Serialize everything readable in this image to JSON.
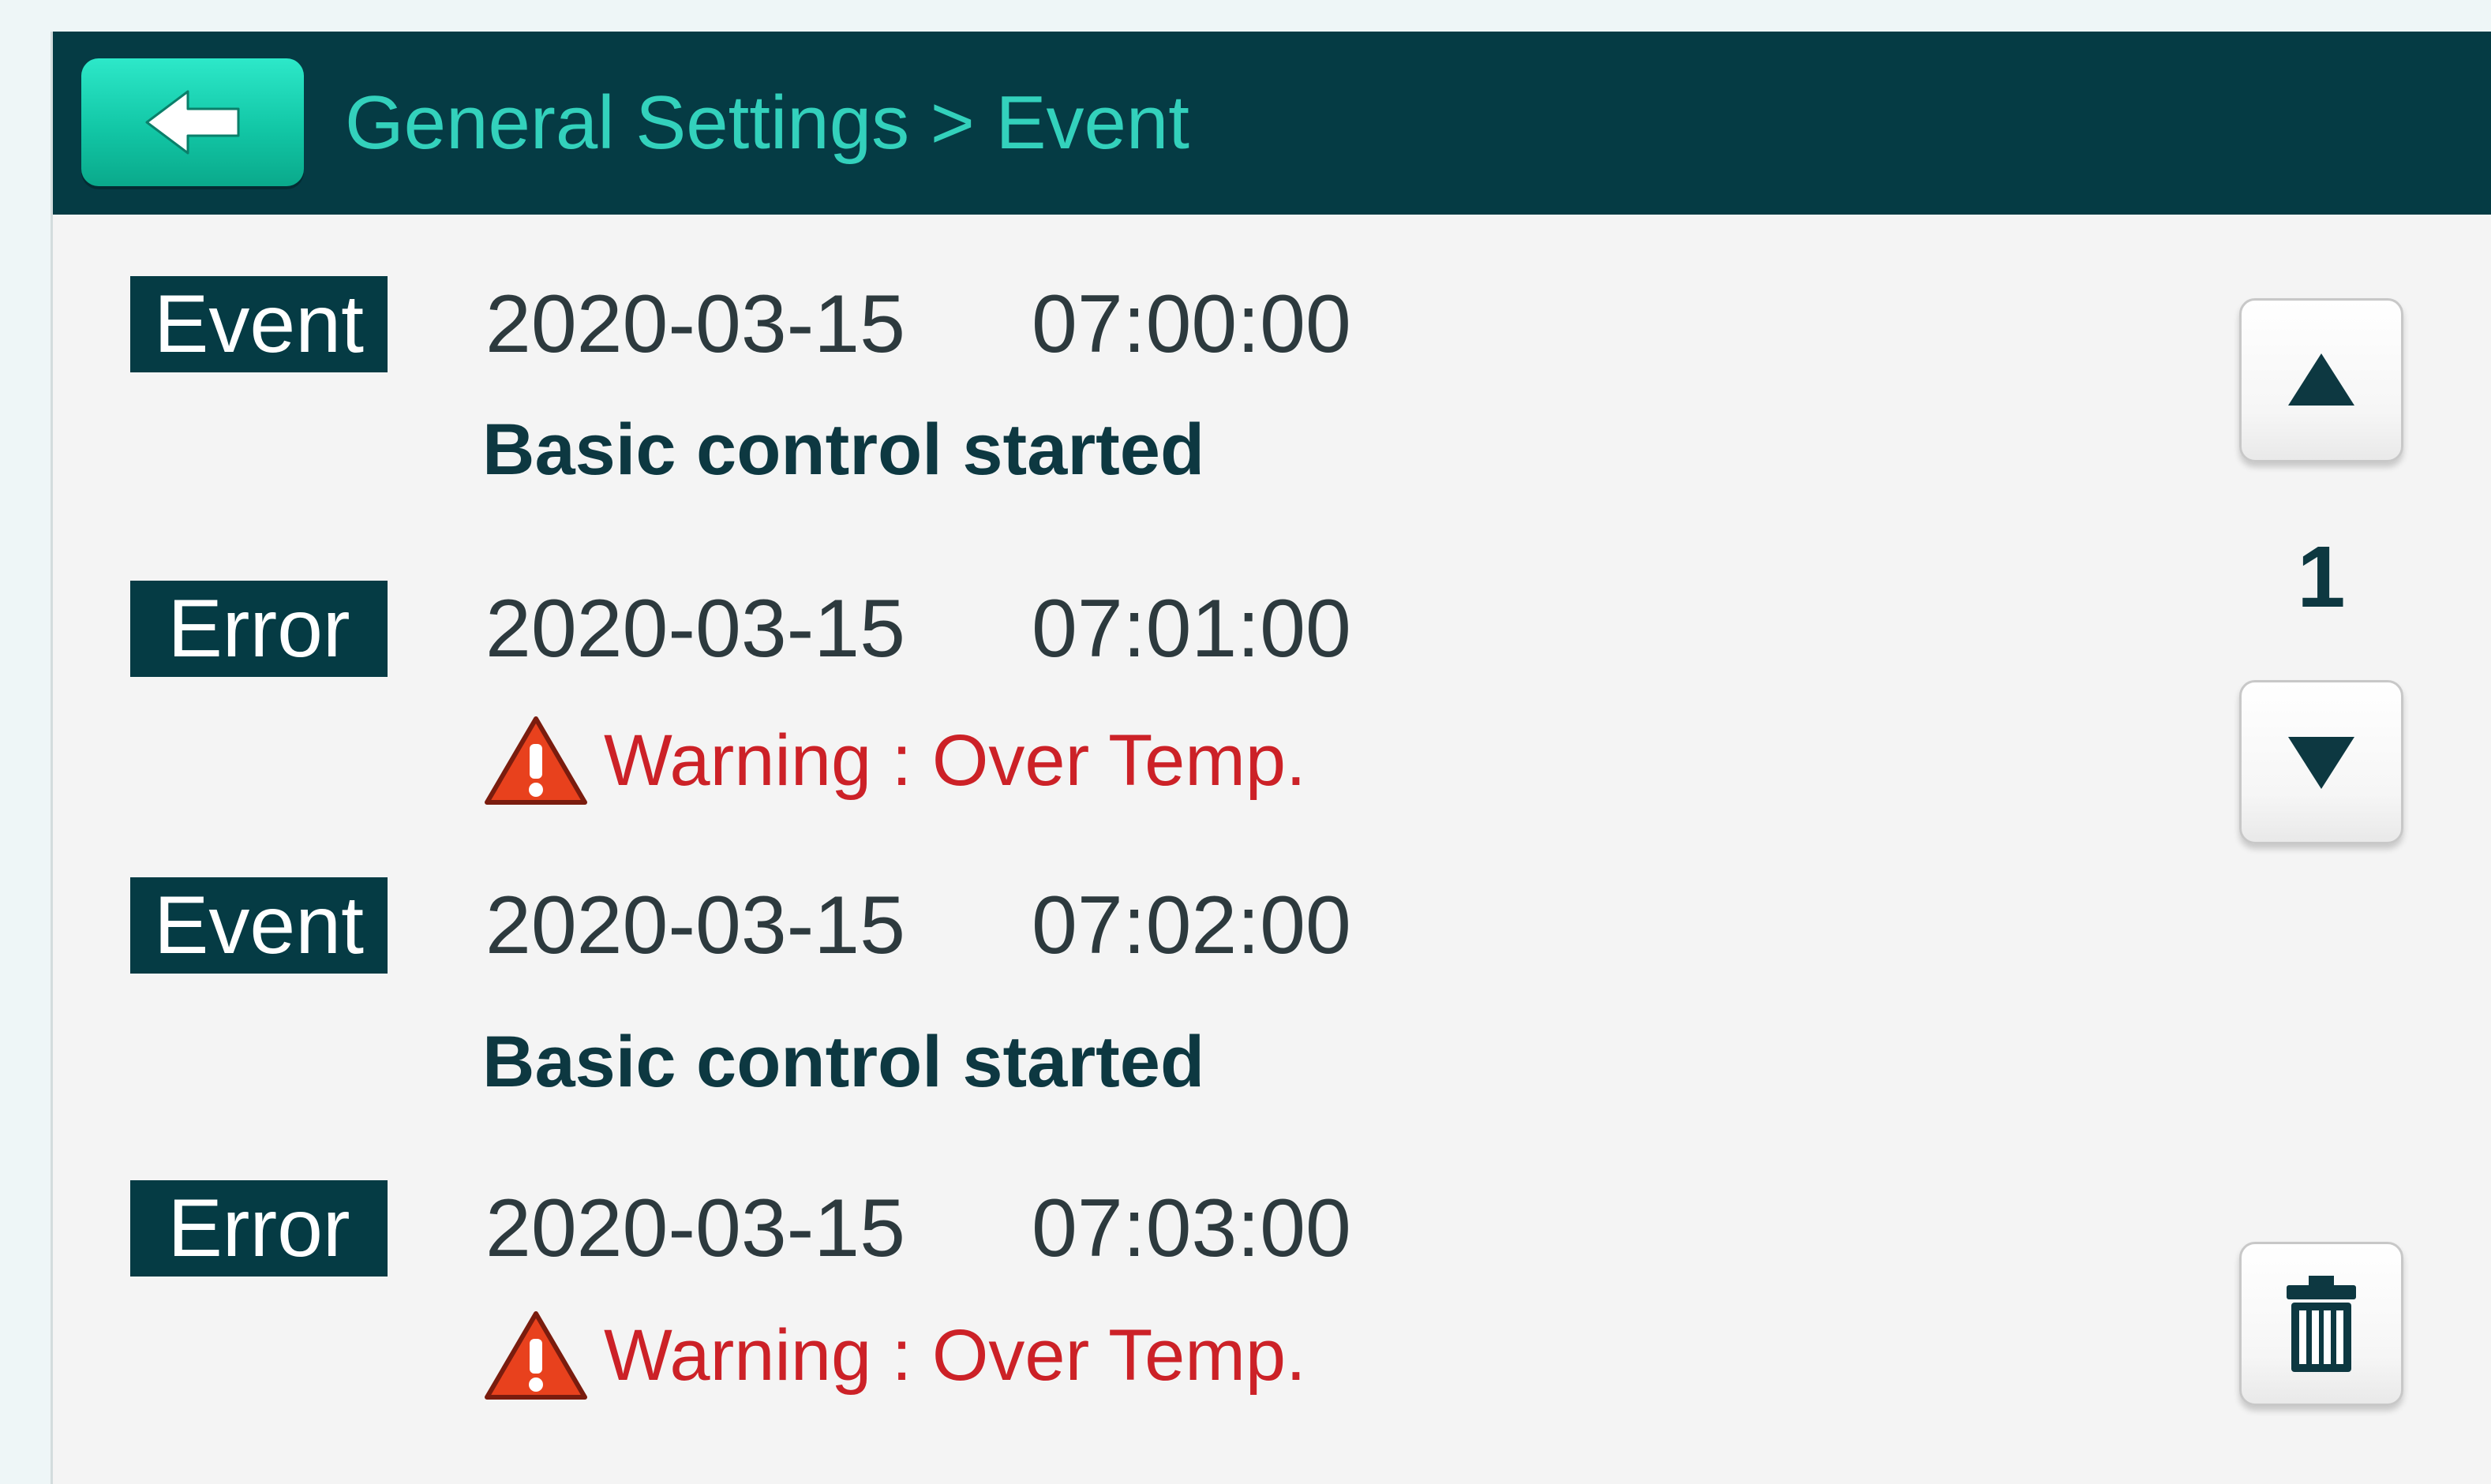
{
  "header": {
    "title": "General Settings > Event",
    "back_icon": "arrow-left-icon"
  },
  "events": [
    {
      "type": "Event",
      "date": "2020-03-15",
      "time": "07:00:00",
      "description": "Basic control started",
      "is_warning": false
    },
    {
      "type": "Error",
      "date": "2020-03-15",
      "time": "07:01:00",
      "description": "Warning : Over Temp.",
      "is_warning": true
    },
    {
      "type": "Event",
      "date": "2020-03-15",
      "time": "07:02:00",
      "description": "Basic control started",
      "is_warning": false
    },
    {
      "type": "Error",
      "date": "2020-03-15",
      "time": "07:03:00",
      "description": "Warning : Over Temp.",
      "is_warning": true
    }
  ],
  "pager": {
    "page": "1",
    "up_icon": "triangle-up-icon",
    "down_icon": "triangle-down-icon",
    "delete_icon": "trash-icon"
  },
  "colors": {
    "header_bg": "#053b44",
    "title_text": "#33d1bc",
    "back_button": "#12c7a6",
    "badge_bg": "#053b44",
    "warning_text": "#cc2127",
    "warning_icon": "#e8411d"
  }
}
